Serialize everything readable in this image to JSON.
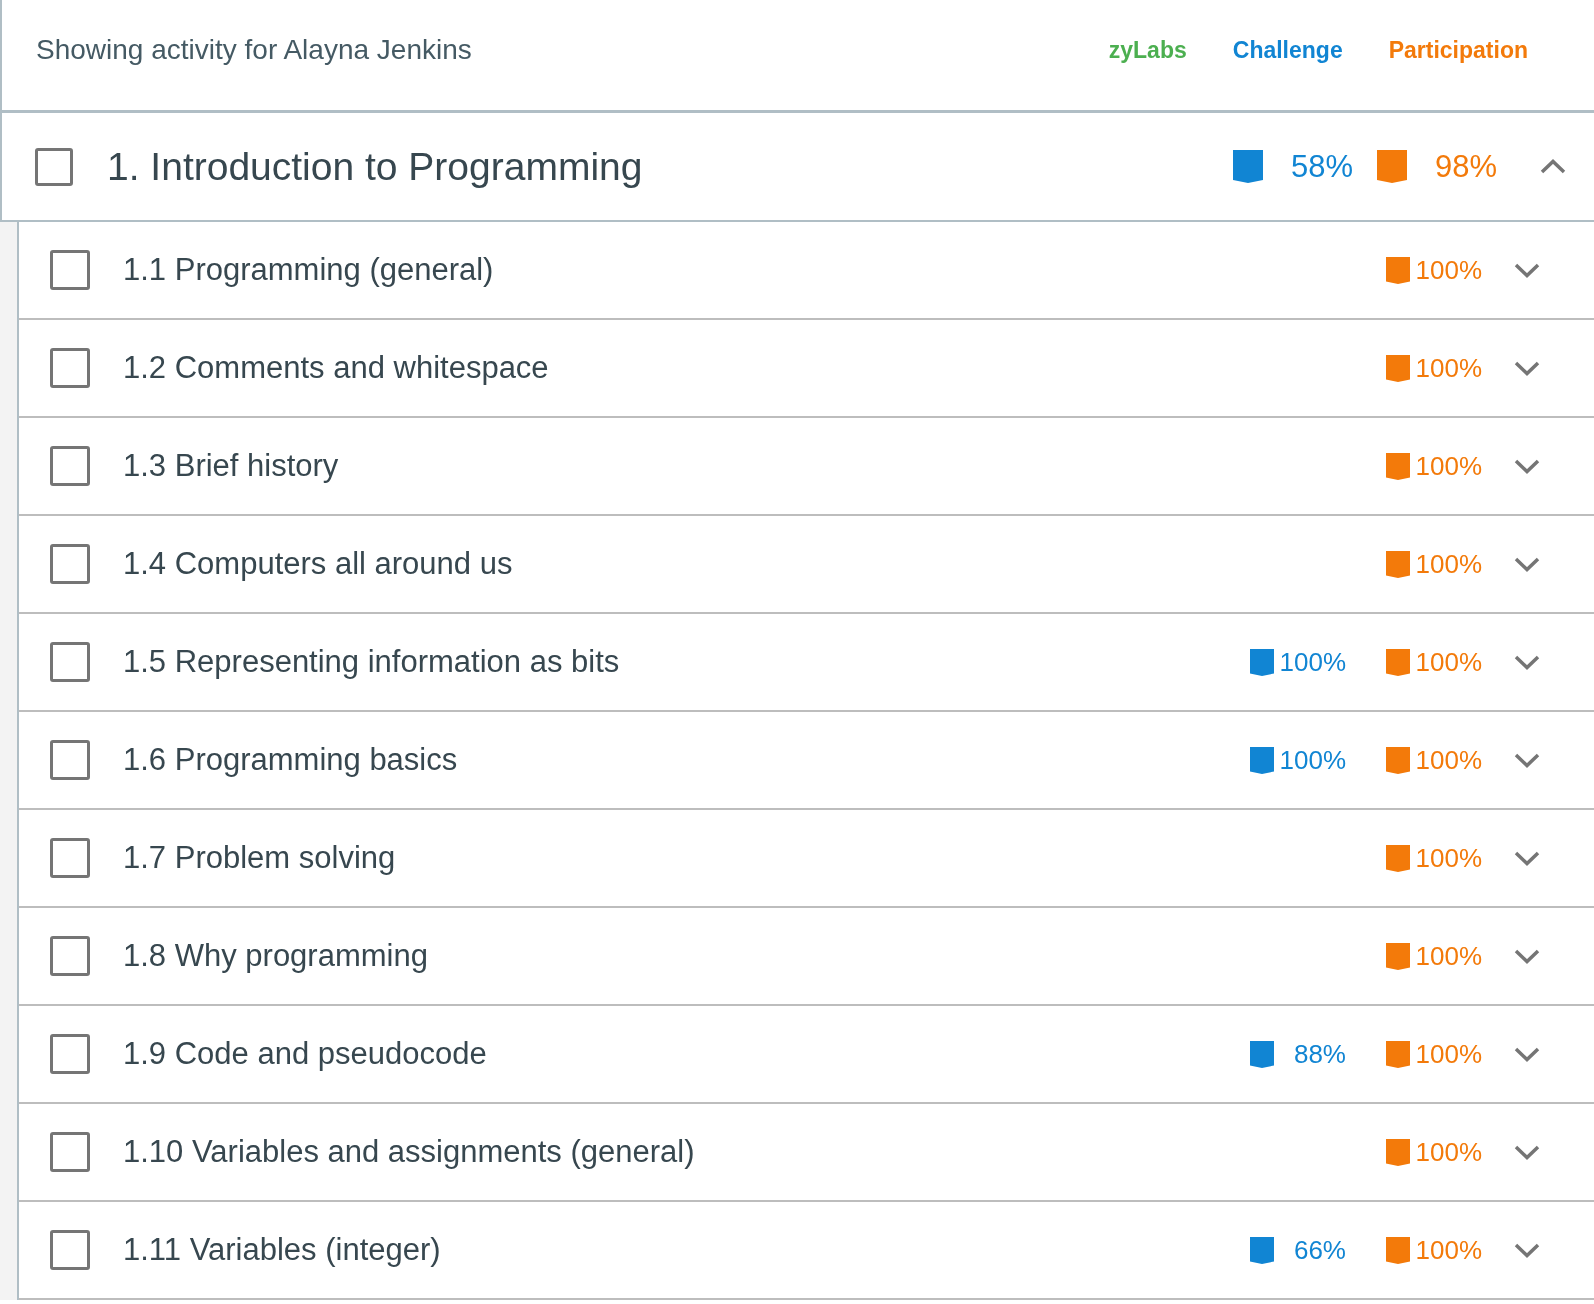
{
  "header": {
    "title": "Showing activity for Alayna Jenkins",
    "legend": [
      {
        "label": "zyLabs",
        "color": "#4caf50"
      },
      {
        "label": "Challenge",
        "color": "#1185d3"
      },
      {
        "label": "Participation",
        "color": "#f37a0a"
      }
    ]
  },
  "chapter": {
    "title": "1. Introduction to Programming",
    "checked": false,
    "expanded": true,
    "challenge": "58%",
    "participation": "98%",
    "sections": [
      {
        "title": "1.1 Programming (general)",
        "checked": false,
        "expanded": false,
        "participation": "100%"
      },
      {
        "title": "1.2 Comments and whitespace",
        "checked": false,
        "expanded": false,
        "participation": "100%"
      },
      {
        "title": "1.3 Brief history",
        "checked": false,
        "expanded": false,
        "participation": "100%"
      },
      {
        "title": "1.4 Computers all around us",
        "checked": false,
        "expanded": false,
        "participation": "100%"
      },
      {
        "title": "1.5 Representing information as bits",
        "checked": false,
        "expanded": false,
        "challenge": "100%",
        "participation": "100%"
      },
      {
        "title": "1.6 Programming basics",
        "checked": false,
        "expanded": false,
        "challenge": "100%",
        "participation": "100%"
      },
      {
        "title": "1.7 Problem solving",
        "checked": false,
        "expanded": false,
        "participation": "100%"
      },
      {
        "title": "1.8 Why programming",
        "checked": false,
        "expanded": false,
        "participation": "100%"
      },
      {
        "title": "1.9 Code and pseudocode",
        "checked": false,
        "expanded": false,
        "challenge": "88%",
        "participation": "100%"
      },
      {
        "title": "1.10 Variables and assignments (general)",
        "checked": false,
        "expanded": false,
        "participation": "100%"
      },
      {
        "title": "1.11 Variables (integer)",
        "checked": false,
        "expanded": false,
        "challenge": "66%",
        "participation": "100%"
      }
    ]
  }
}
